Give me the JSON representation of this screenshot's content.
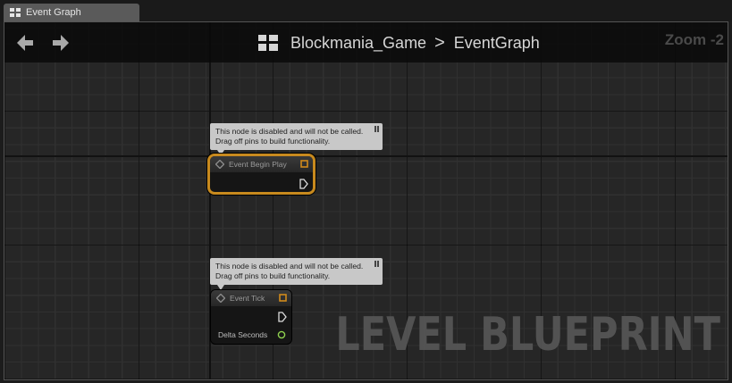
{
  "tab": {
    "label": "Event Graph",
    "icon": "graph-icon"
  },
  "toolbar": {
    "back_icon": "back-arrow-icon",
    "forward_icon": "forward-arrow-icon",
    "breadcrumb_icon": "blueprint-graph-icon",
    "breadcrumb": [
      "Blockmania_Game",
      "EventGraph"
    ],
    "separator": ">",
    "zoom": "Zoom -2"
  },
  "comments": [
    {
      "line1": "This node is disabled and will not be called.",
      "line2": "Drag off pins to build functionality."
    },
    {
      "line1": "This node is disabled and will not be called.",
      "line2": "Drag off pins to build functionality."
    }
  ],
  "nodes": {
    "begin_play": {
      "title": "Event Begin Play",
      "selected": true
    },
    "tick": {
      "title": "Event Tick",
      "output_label": "Delta Seconds"
    }
  },
  "watermark": "LEVEL BLUEPRINT",
  "colors": {
    "selection_outline": "#c88a1e",
    "delegate_pin": "#d08a1c",
    "float_pin": "#8fd14f",
    "comment_bg": "#c8c8c8"
  }
}
